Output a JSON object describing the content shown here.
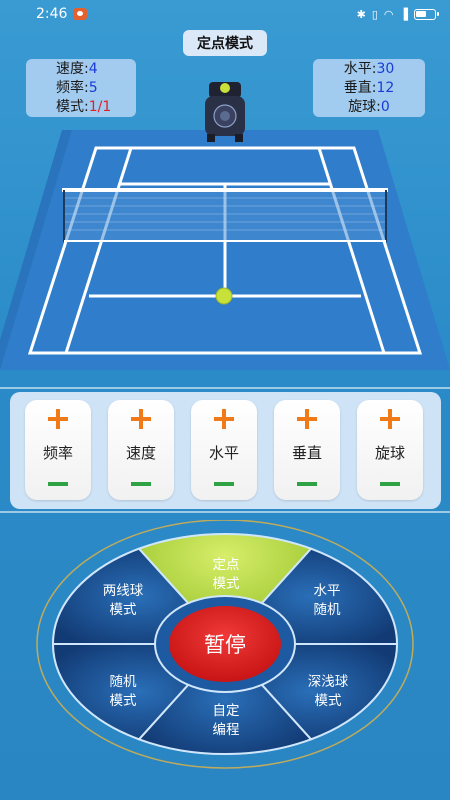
{
  "status_bar": {
    "time": "2:46",
    "battery_level": 0.5
  },
  "mode_title": "定点模式",
  "left_stats": {
    "speed_label": "速度:",
    "speed_value": "4",
    "frequency_label": "频率:",
    "frequency_value": "5",
    "mode_label": "模式:",
    "mode_value": "1/1"
  },
  "right_stats": {
    "horizontal_label": "水平:",
    "horizontal_value": "30",
    "vertical_label": "垂直:",
    "vertical_value": "12",
    "spin_label": "旋球:",
    "spin_value": "0"
  },
  "controls": [
    {
      "label": "频率"
    },
    {
      "label": "速度"
    },
    {
      "label": "水平"
    },
    {
      "label": "垂直"
    },
    {
      "label": "旋球"
    }
  ],
  "wheel": {
    "center_label": "暂停",
    "segments": [
      {
        "line1": "定点",
        "line2": "模式",
        "active": true
      },
      {
        "line1": "水平",
        "line2": "随机",
        "active": false
      },
      {
        "line1": "深浅球",
        "line2": "模式",
        "active": false
      },
      {
        "line1": "自定",
        "line2": "编程",
        "active": false
      },
      {
        "line1": "随机",
        "line2": "模式",
        "active": false
      },
      {
        "line1": "两线球",
        "line2": "模式",
        "active": false
      }
    ]
  },
  "colors": {
    "accent_orange": "#f07a18",
    "accent_green": "#2fa244",
    "active_segment": "#b8dc3a",
    "pause_red": "#e02020",
    "court_blue": "#2e79c8"
  }
}
